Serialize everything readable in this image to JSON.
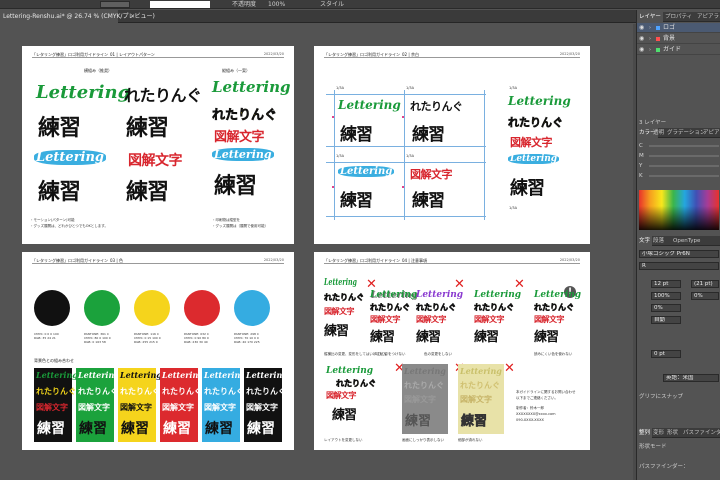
{
  "app": {
    "doc_tab": "Lettering-Renshu.ai* @ 26.74 % (CMYK/プレビュー)",
    "doc_tab_close": "✕"
  },
  "controlbar": {
    "opacity_label": "不透明度",
    "opacity_value": "100%",
    "style_label": "スタイル"
  },
  "artboards": {
    "ab1": {
      "title": "「レタリング練習」ロゴ利用ガイドライン",
      "section": "01 | レイアウトパターン",
      "date": "2022/03/20",
      "col1_label": "横組み（推奨）",
      "col2_label": "縦組み（一案）",
      "notes": [
        "・モーション(パターン)可能",
        "・グッズ展開は、どれかひとつでもOKとします。",
        "・印刷物は縦型を",
        "・グッズ展開は（展開で使用可能）"
      ]
    },
    "ab2": {
      "title": "「レタリング練習」ロゴ利用ガイドライン",
      "section": "02 | 余白",
      "date": "2022/03/20",
      "margin_marks": [
        "1/3A",
        "1/3A",
        "1/3A",
        "1/3A",
        "1/3A",
        "1/3A"
      ]
    },
    "ab3": {
      "title": "「レタリング練習」ロゴ利用ガイドライン",
      "section": "03 | 色",
      "date": "2022/03/20",
      "bg_label": "背景色との組み合わせ",
      "colors": [
        {
          "name": "black",
          "hex": "#111111",
          "spec": "CMYK: 0 0 0 100\nRGB: 35 24 21"
        },
        {
          "name": "green",
          "hex": "#1ba23c",
          "spec": "PANTONE: 361 C\nCMYK: 80 0 100 0\nRGB: 0 163 58"
        },
        {
          "name": "yellow",
          "hex": "#f5d41c",
          "spec": "PANTONE: 116 C\nCMYK: 0 15 100 0\nRGB: 255 215 0"
        },
        {
          "name": "red",
          "hex": "#dc2a2e",
          "spec": "PANTONE: 032 C\nCMYK: 0 90 80 0\nRGB: 230 30 40"
        },
        {
          "name": "blue",
          "hex": "#35ace1",
          "spec": "PANTONE: 298 C\nCMYK: 70 10 0 0\nRGB: 40 170 225"
        }
      ],
      "bg_swatches": [
        "#111111",
        "#1ba23c",
        "#f5d41c",
        "#dc2a2e",
        "#35ace1",
        "#111111"
      ]
    },
    "ab4": {
      "title": "「レタリング練習」ロゴ利用ガイドライン",
      "section": "04 | 注意事項",
      "date": "2022/03/20",
      "captions": [
        "縦横比の変更、変形をしてはいけません",
        "ロゴに影をつけない",
        "色の変更をしない",
        "",
        "読みにくい色を使わない"
      ],
      "row2_captions": [
        "レイアウトを変更しない",
        "画面にしっかり表示しない",
        "細部が潰れない"
      ],
      "contact_lines": [
        "本ガイドラインに関するお問い合わせ",
        "以下までご連絡ください。",
        "制作者：鈴木一郎",
        "XXXXXXXX@xxxx.com",
        "090-XXXX-XXXX"
      ]
    }
  },
  "logo_text": {
    "lettering": "Lettering",
    "hiragana": "れたりんぐ",
    "kanji": "練習",
    "box_kanji": "図解文字"
  },
  "panels": {
    "layers_tabs": [
      "レイヤー",
      "プロパティ",
      "アピアランス"
    ],
    "layers": [
      {
        "name": "ロゴ",
        "color": "#4fa3ff"
      },
      {
        "name": "背景",
        "color": "#ff4f4f"
      },
      {
        "name": "ガイド",
        "color": "#4fdf6f"
      }
    ],
    "layers_footer": "3 レイヤー",
    "color_tabs": [
      "カラー",
      "透明",
      "グラデーション",
      "アピアランス"
    ],
    "cmyk_labels": [
      "C",
      "M",
      "Y",
      "K"
    ],
    "type_tabs": [
      "文字",
      "段落",
      "OpenType"
    ],
    "font_family": "小塚ゴシック Pr6N",
    "font_style": "R",
    "font_size": "12 pt",
    "leading": "(21 pt)",
    "tracking": "100%",
    "kerning": "0%",
    "baseline": "0 pt",
    "auto": "自動",
    "lang": "英語：米国",
    "glyph_section": "グリフにスナップ",
    "align_tabs": [
      "整列",
      "変形",
      "形状",
      "パスファインダー"
    ],
    "shape_modes": "形状モード",
    "pathfinder": "パスファインダー："
  }
}
